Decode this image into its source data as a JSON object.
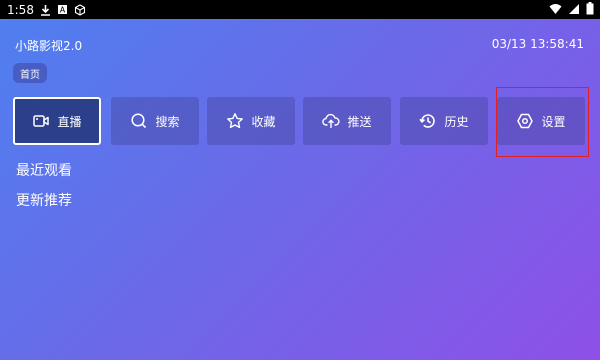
{
  "status_bar": {
    "time": "1:58",
    "icons_left": [
      "download-icon",
      "notification-icon",
      "cube-icon"
    ],
    "icons_right": [
      "wifi-icon",
      "signal-icon",
      "battery-icon"
    ]
  },
  "header": {
    "app_title": "小路影视2.0",
    "datetime": "03/13 13:58:41",
    "home_chip": "首页"
  },
  "nav": [
    {
      "label": "直播",
      "icon": "video-camera-icon",
      "active": true
    },
    {
      "label": "搜索",
      "icon": "search-icon",
      "active": false
    },
    {
      "label": "收藏",
      "icon": "star-icon",
      "active": false
    },
    {
      "label": "推送",
      "icon": "cloud-upload-icon",
      "active": false
    },
    {
      "label": "历史",
      "icon": "history-icon",
      "active": false
    },
    {
      "label": "设置",
      "icon": "settings-icon",
      "active": false
    }
  ],
  "sections": {
    "recent": "最近观看",
    "updates": "更新推荐"
  },
  "colors": {
    "gradient_start": "#4e80f0",
    "gradient_end": "#8e50e8",
    "active_button": "#2c3f8a",
    "highlight_box": "#e41f1f"
  }
}
